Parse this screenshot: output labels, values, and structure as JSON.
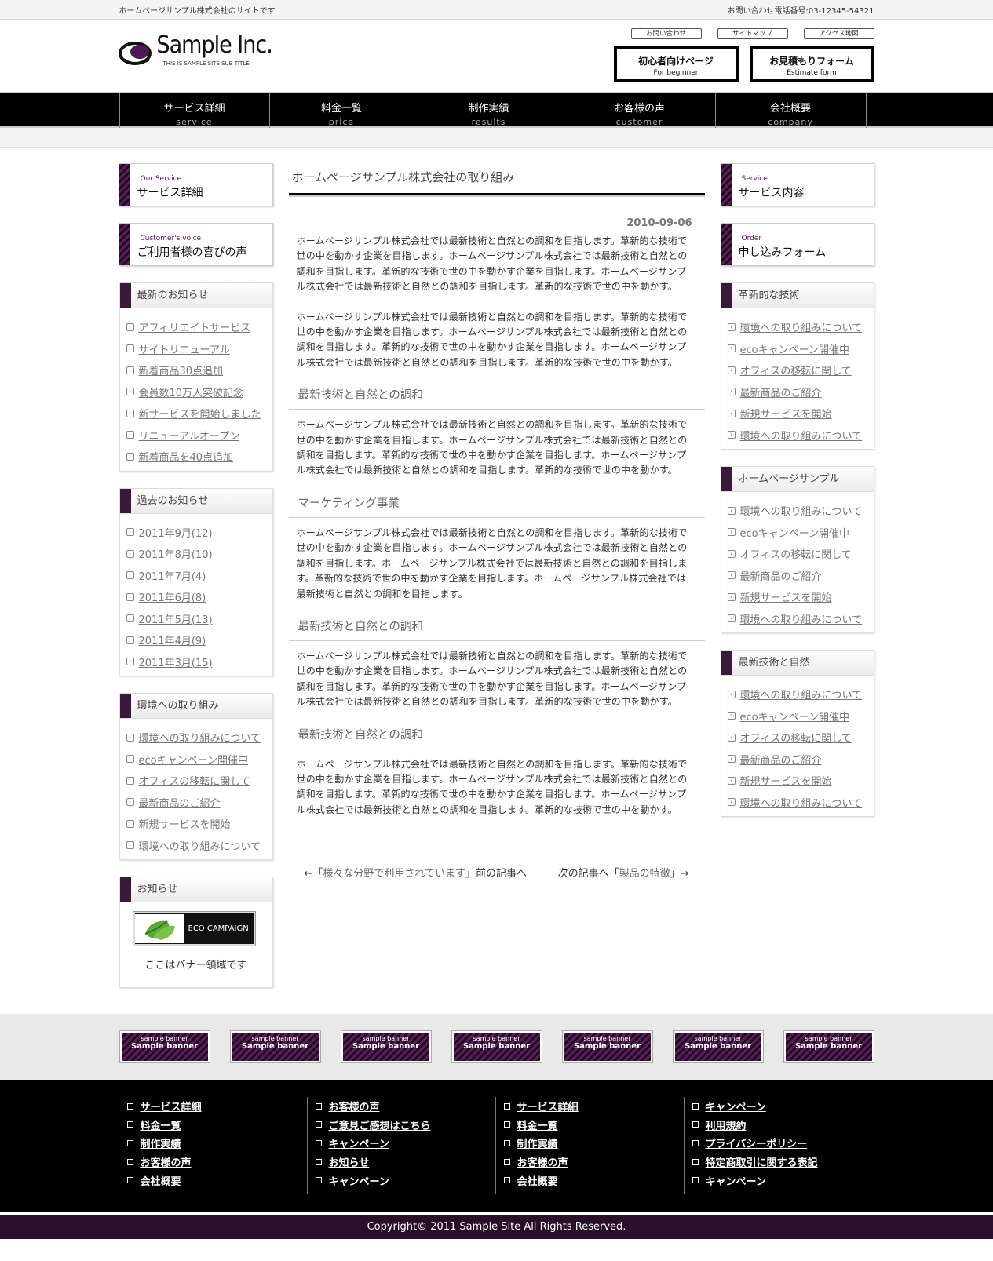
{
  "topbar": {
    "tagline": "ホームページサンプル株式会社のサイトです",
    "phone": "お問い合わせ電話番号:03-12345-54321"
  },
  "header": {
    "logo_name": "Sample Inc.",
    "logo_sub": "THIS IS SAMPLE SITE SUB TITLE",
    "links": [
      "お問い合わせ",
      "サイトマップ",
      "アクセス地図"
    ],
    "buttons": [
      {
        "jp": "初心者向けページ",
        "en": "For beginner"
      },
      {
        "jp": "お見積もりフォーム",
        "en": "Estimate form"
      }
    ]
  },
  "nav": [
    {
      "jp": "サービス詳細",
      "en": "service"
    },
    {
      "jp": "料金一覧",
      "en": "price"
    },
    {
      "jp": "制作実績",
      "en": "results"
    },
    {
      "jp": "お客様の声",
      "en": "customer"
    },
    {
      "jp": "会社概要",
      "en": "company"
    }
  ],
  "left": {
    "head1": {
      "en": "Our Service",
      "jp": "サービス詳細"
    },
    "head2": {
      "en": "Customer's voice",
      "jp": "ご利用者様の喜びの声"
    },
    "news_title": "最新のお知らせ",
    "news": [
      "アフィリエイトサービス",
      "サイトリニューアル",
      "新着商品30点追加",
      "会員数10万人突破記念",
      "新サービスを開始しました",
      "リニューアルオープン",
      "新着商品を40点追加"
    ],
    "past_title": "過去のお知らせ",
    "past": [
      "2011年9月(12)",
      "2011年8月(10)",
      "2011年7月(4)",
      "2011年6月(8)",
      "2011年5月(13)",
      "2011年4月(9)",
      "2011年3月(15)"
    ],
    "env_title": "環境への取り組み",
    "env": [
      "環境への取り組みについて",
      "ecoキャンペーン開催中",
      "オフィスの移転に関して",
      "最新商品のご紹介",
      "新規サービスを開始",
      "環境への取り組みについて"
    ],
    "info_title": "お知らせ",
    "eco_banner": "ECO CAMPAIGN",
    "banner_note": "ここはバナー領域です"
  },
  "article": {
    "title": "ホームページサンプル株式会社の取り組み",
    "date": "2010-09-06",
    "p1": "ホームページサンプル株式会社では最新技術と自然との調和を目指します。革新的な技術で世の中を動かす企業を目指します。ホームページサンプル株式会社では最新技術と自然との調和を目指します。革新的な技術で世の中を動かす企業を目指します。ホームページサンプル株式会社では最新技術と自然との調和を目指します。革新的な技術で世の中を動かす。",
    "p2": "ホームページサンプル株式会社では最新技術と自然との調和を目指します。革新的な技術で世の中を動かす企業を目指します。ホームページサンプル株式会社では最新技術と自然との調和を目指します。革新的な技術で世の中を動かす企業を目指します。ホームページサンプル株式会社では最新技術と自然との調和を目指します。革新的な技術で世の中を動かす。",
    "h3a": "最新技術と自然との調和",
    "p3": "ホームページサンプル株式会社では最新技術と自然との調和を目指します。革新的な技術で世の中を動かす企業を目指します。ホームページサンプル株式会社では最新技術と自然との調和を目指します。革新的な技術で世の中を動かす企業を目指します。ホームページサンプル株式会社では最新技術と自然との調和を目指します。革新的な技術で世の中を動かす。",
    "h3b": "マーケティング事業",
    "p4": "ホームページサンプル株式会社では最新技術と自然との調和を目指します。革新的な技術で世の中を動かす企業を目指します。ホームページサンプル株式会社では最新技術と自然との調和を目指します。ホームページサンプル株式会社では最新技術と自然との調和を目指します。革新的な技術で世の中を動かす企業を目指します。ホームページサンプル株式会社では最新技術と自然との調和を目指します。",
    "h3c": "最新技術と自然との調和",
    "p5": "ホームページサンプル株式会社では最新技術と自然との調和を目指します。革新的な技術で世の中を動かす企業を目指します。ホームページサンプル株式会社では最新技術と自然との調和を目指します。革新的な技術で世の中を動かす企業を目指します。ホームページサンプル株式会社では最新技術と自然との調和を目指します。革新的な技術で世の中を動かす。",
    "h3d": "最新技術と自然との調和",
    "p6": "ホームページサンプル株式会社では最新技術と自然との調和を目指します。革新的な技術で世の中を動かす企業を目指します。ホームページサンプル株式会社では最新技術と自然との調和を目指します。革新的な技術で世の中を動かす企業を目指します。ホームページサンプル株式会社では最新技術と自然との調和を目指します。革新的な技術で世の中を動かす。",
    "prev_pre": "←「",
    "prev_link": "様々な分野で利用されています",
    "prev_post": "」前の記事へ",
    "next_pre": "次の記事へ「",
    "next_link": "製品の特徴",
    "next_post": "」→"
  },
  "right": {
    "head1": {
      "en": "Service",
      "jp": "サービス内容"
    },
    "head2": {
      "en": "Order",
      "jp": "申し込みフォーム"
    },
    "box1_title": "革新的な技術",
    "box2_title": "ホームページサンプル",
    "box3_title": "最新技術と自然",
    "items": [
      "環境への取り組みについて",
      "ecoキャンペーン開催中",
      "オフィスの移転に関して",
      "最新商品のご紹介",
      "新規サービスを開始",
      "環境への取り組みについて"
    ]
  },
  "banners": {
    "small": "sample banner",
    "big": "Sample banner"
  },
  "footer": {
    "col1": [
      "サービス詳細",
      "料金一覧",
      "制作実績",
      "お客様の声",
      "会社概要"
    ],
    "col2": [
      "お客様の声",
      "ご意見ご感想はこちら",
      "キャンペーン",
      "お知らせ",
      "キャンペーン"
    ],
    "col3": [
      "サービス詳細",
      "料金一覧",
      "制作実績",
      "お客様の声",
      "会社概要"
    ],
    "col4": [
      "キャンペーン",
      "利用規約",
      "プライバシーポリシー",
      "特定商取引に関する表記",
      "キャンペーン"
    ],
    "copyright": "Copyright© 2011 Sample Site All Rights Reserved."
  },
  "colors": {
    "accent": "#5a1060",
    "nav_bg": "#000000",
    "footer_bg": "#000000",
    "copyright_bg": "#2a0f2a"
  }
}
